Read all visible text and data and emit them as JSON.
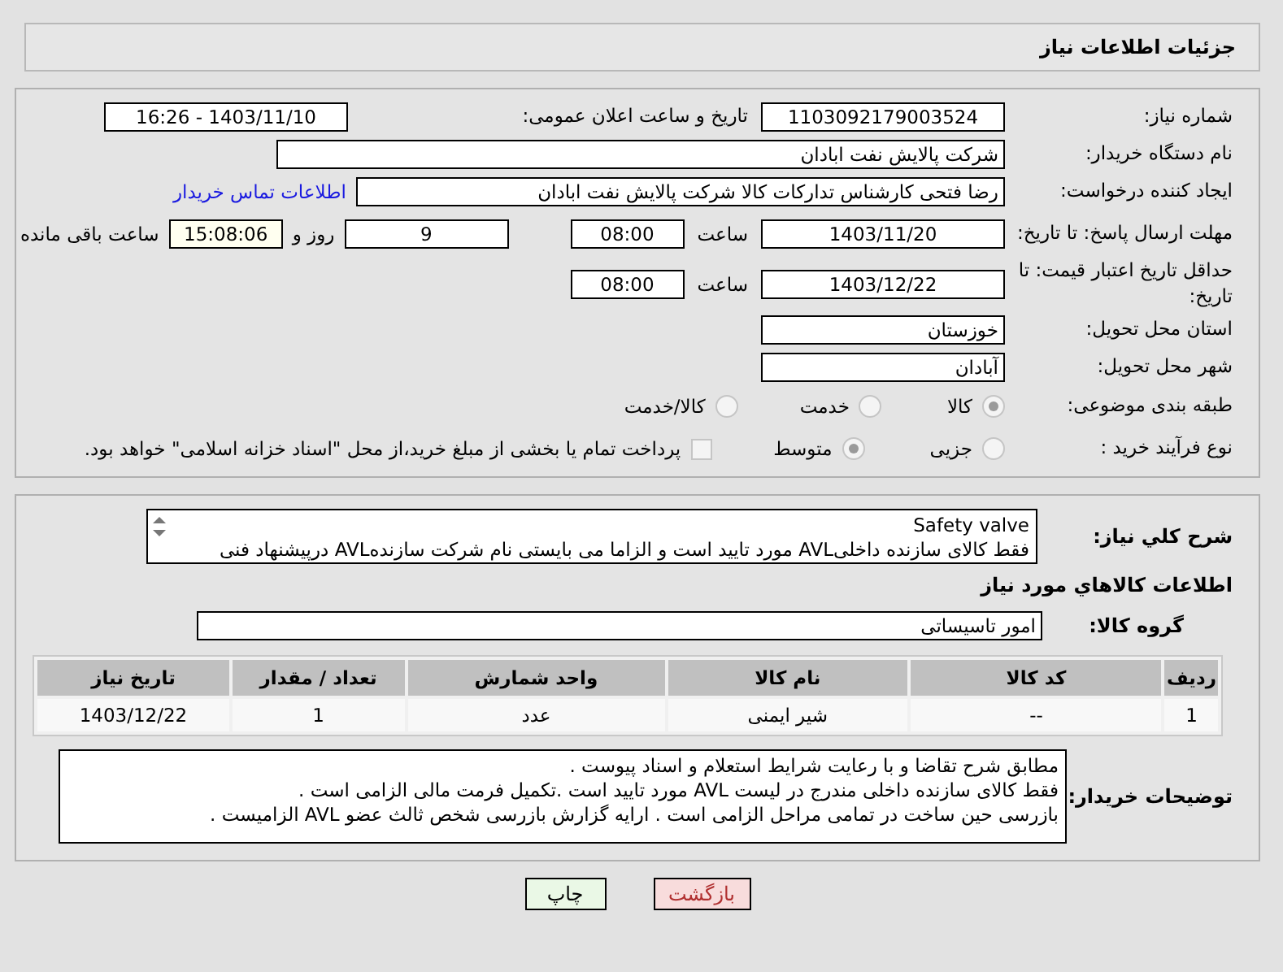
{
  "page_title": "جزئیات اطلاعات نیاز",
  "need_number": {
    "label": "شماره نیاز:",
    "value": "1103092179003524"
  },
  "announce": {
    "label": "تاریخ و ساعت اعلان عمومی:",
    "value": "1403/11/10 - 16:26"
  },
  "buyer": {
    "label": "نام دستگاه خریدار:",
    "value": "شرکت پالایش نفت ابادان"
  },
  "creator": {
    "label": "ایجاد کننده درخواست:",
    "value": "رضا فتحی کارشناس تدارکات کالا  شرکت پالایش نفت ابادان",
    "link": "اطلاعات تماس خریدار"
  },
  "deadline": {
    "label": "مهلت ارسال پاسخ: تا تاریخ:",
    "date": "1403/11/20",
    "time_label": "ساعت",
    "time": "08:00",
    "days": "9",
    "days_label": "روز و",
    "remaining": "15:08:06",
    "remaining_label": "ساعت باقی مانده"
  },
  "validity": {
    "label": "حداقل تاریخ اعتبار قیمت: تا تاریخ:",
    "date": "1403/12/22",
    "time_label": "ساعت",
    "time": "08:00"
  },
  "province": {
    "label": "استان محل تحویل:",
    "value": "خوزستان"
  },
  "city": {
    "label": "شهر محل تحویل:",
    "value": "آبادان"
  },
  "category": {
    "label": "طبقه بندی موضوعی:",
    "options": [
      {
        "label": "کالا",
        "selected": true
      },
      {
        "label": "خدمت",
        "selected": false
      },
      {
        "label": "کالا/خدمت",
        "selected": false
      }
    ]
  },
  "purchase_type": {
    "label": "نوع فرآیند خرید :",
    "options": [
      {
        "label": "جزیی",
        "selected": false
      },
      {
        "label": "متوسط",
        "selected": true
      }
    ],
    "payment_checkbox": {
      "checked": false,
      "text": "پرداخت تمام یا بخشی از مبلغ خرید،از محل \"اسناد خزانه اسلامی\" خواهد بود."
    }
  },
  "description": {
    "label": "شرح كلي نياز:",
    "lines": [
      "Safety valve",
      "فقط کالای سازنده داخلیAVL مورد تایید است و الزاما می بایستی نام شرکت سازندهAVL درپیشنهاد فنی"
    ]
  },
  "items_title": "اطلاعات كالاهاي مورد نياز",
  "goods_group": {
    "label": "گروه کالا:",
    "value": "امور تاسیساتی"
  },
  "table": {
    "columns": [
      "ردیف",
      "کد کالا",
      "نام کالا",
      "واحد شمارش",
      "تعداد / مقدار",
      "تاریخ نیاز"
    ],
    "rows": [
      [
        "1",
        "--",
        "شیر ایمنی",
        "عدد",
        "1",
        "1403/12/22"
      ]
    ]
  },
  "buyer_notes": {
    "label": "توضیحات خریدار:",
    "lines": [
      "مطابق شرح تقاضا و با رعایت شرایط استعلام و اسناد پیوست .",
      "فقط کالای سازنده داخلی مندرج در لیست AVL مورد تایید است .تکمیل فرمت مالی الزامی است .",
      "بازرسی حین ساخت در تمامی مراحل الزامی است . ارایه گزارش بازرسی شخص ثالث عضو  AVL  الزامیست ."
    ]
  },
  "buttons": [
    {
      "label": "بازگشت",
      "kind": "back"
    },
    {
      "label": "چاپ",
      "kind": "print"
    }
  ]
}
